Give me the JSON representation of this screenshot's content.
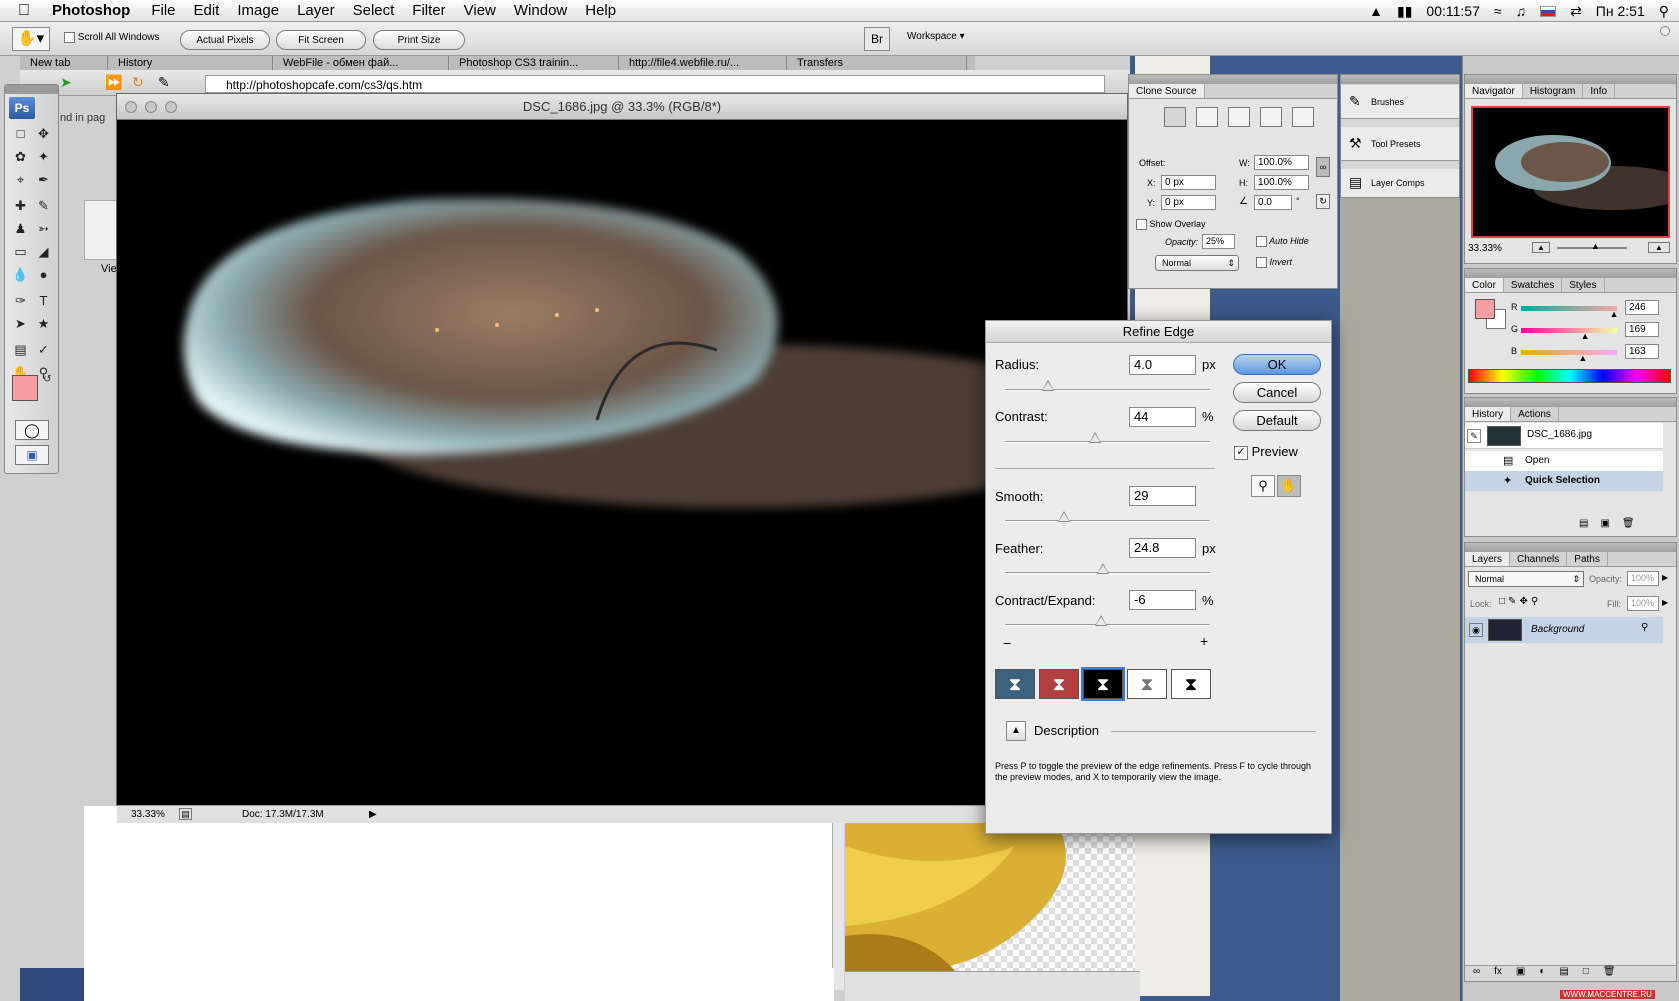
{
  "menubar": {
    "app_name": "Photoshop",
    "items": [
      "File",
      "Edit",
      "Image",
      "Layer",
      "Select",
      "Filter",
      "View",
      "Window",
      "Help"
    ],
    "clock": "00:11:57",
    "day_time": "Пн 2:51"
  },
  "options_bar": {
    "scroll_all_windows": "Scroll All Windows",
    "actual_pixels": "Actual Pixels",
    "fit_screen": "Fit Screen",
    "print_size": "Print Size",
    "workspace": "Workspace"
  },
  "browser": {
    "tabs": [
      "New tab",
      "History",
      "WebFile - обмен фай...",
      "Photoshop CS3 trainin...",
      "http://file4.webfile.ru/...",
      "Transfers"
    ],
    "url": "http://photoshopcafe.com/cs3/qs.htm",
    "side_text_1": "nd in pag",
    "side_text_2": "Vie"
  },
  "document": {
    "title": "DSC_1686.jpg @ 33.3% (RGB/8*)",
    "zoom": "33.33%",
    "doc_size": "Doc: 17.3M/17.3M"
  },
  "clone_source": {
    "tab": "Clone Source",
    "offset_label": "Offset:",
    "w_label": "W:",
    "w_value": "100.0%",
    "h_label": "H:",
    "h_value": "100.0%",
    "x_label": "X:",
    "x_value": "0 px",
    "y_label": "Y:",
    "y_value": "0 px",
    "angle_value": "0.0",
    "angle_unit": "°",
    "show_overlay": "Show Overlay",
    "opacity_label": "Opacity:",
    "opacity_value": "25%",
    "auto_hide": "Auto Hide",
    "mode": "Normal",
    "invert": "Invert"
  },
  "mini_panels": {
    "brushes": "Brushes",
    "tool_presets": "Tool Presets",
    "layer_comps": "Layer Comps"
  },
  "navigator": {
    "tabs": [
      "Navigator",
      "Histogram",
      "Info"
    ],
    "zoom": "33.33%"
  },
  "color_panel": {
    "tabs": [
      "Color",
      "Swatches",
      "Styles"
    ],
    "r_label": "R",
    "r_value": "246",
    "r_level": 0.965,
    "g_label": "G",
    "g_value": "169",
    "g_level": 0.663,
    "b_label": "B",
    "b_value": "163",
    "b_level": 0.639,
    "foreground": "#f69fa3"
  },
  "history_panel": {
    "tabs": [
      "History",
      "Actions"
    ],
    "snapshot": "DSC_1686.jpg",
    "items": [
      "Open",
      "Quick Selection"
    ]
  },
  "layers_panel": {
    "tabs": [
      "Layers",
      "Channels",
      "Paths"
    ],
    "blend": "Normal",
    "opacity_label": "Opacity:",
    "opacity_value": "100%",
    "lock_label": "Lock:",
    "fill_label": "Fill:",
    "fill_value": "100%",
    "layer_name": "Background"
  },
  "refine_edge": {
    "title": "Refine Edge",
    "radius_label": "Radius:",
    "radius_value": "4.0",
    "radius_unit": "px",
    "radius_level": 0.21,
    "contrast_label": "Contrast:",
    "contrast_value": "44",
    "contrast_unit": "%",
    "contrast_level": 0.44,
    "smooth_label": "Smooth:",
    "smooth_value": "29",
    "smooth_level": 0.29,
    "feather_label": "Feather:",
    "feather_value": "24.8",
    "feather_unit": "px",
    "feather_level": 0.48,
    "contract_label": "Contract/Expand:",
    "contract_value": "-6",
    "contract_unit": "%",
    "contract_level": 0.47,
    "minus": "−",
    "plus": "+",
    "ok": "OK",
    "cancel": "Cancel",
    "default": "Default",
    "preview": "Preview",
    "description_label": "Description",
    "description_text": "Press P to toggle the preview of the edge refinements. Press F to cycle through the preview modes, and X to temporarily view the image."
  },
  "watermark": "WWW.MACCENTRE.RU",
  "colors": {
    "accent": "#3c7fd8",
    "foreground_swatch": "#f69fa3"
  }
}
